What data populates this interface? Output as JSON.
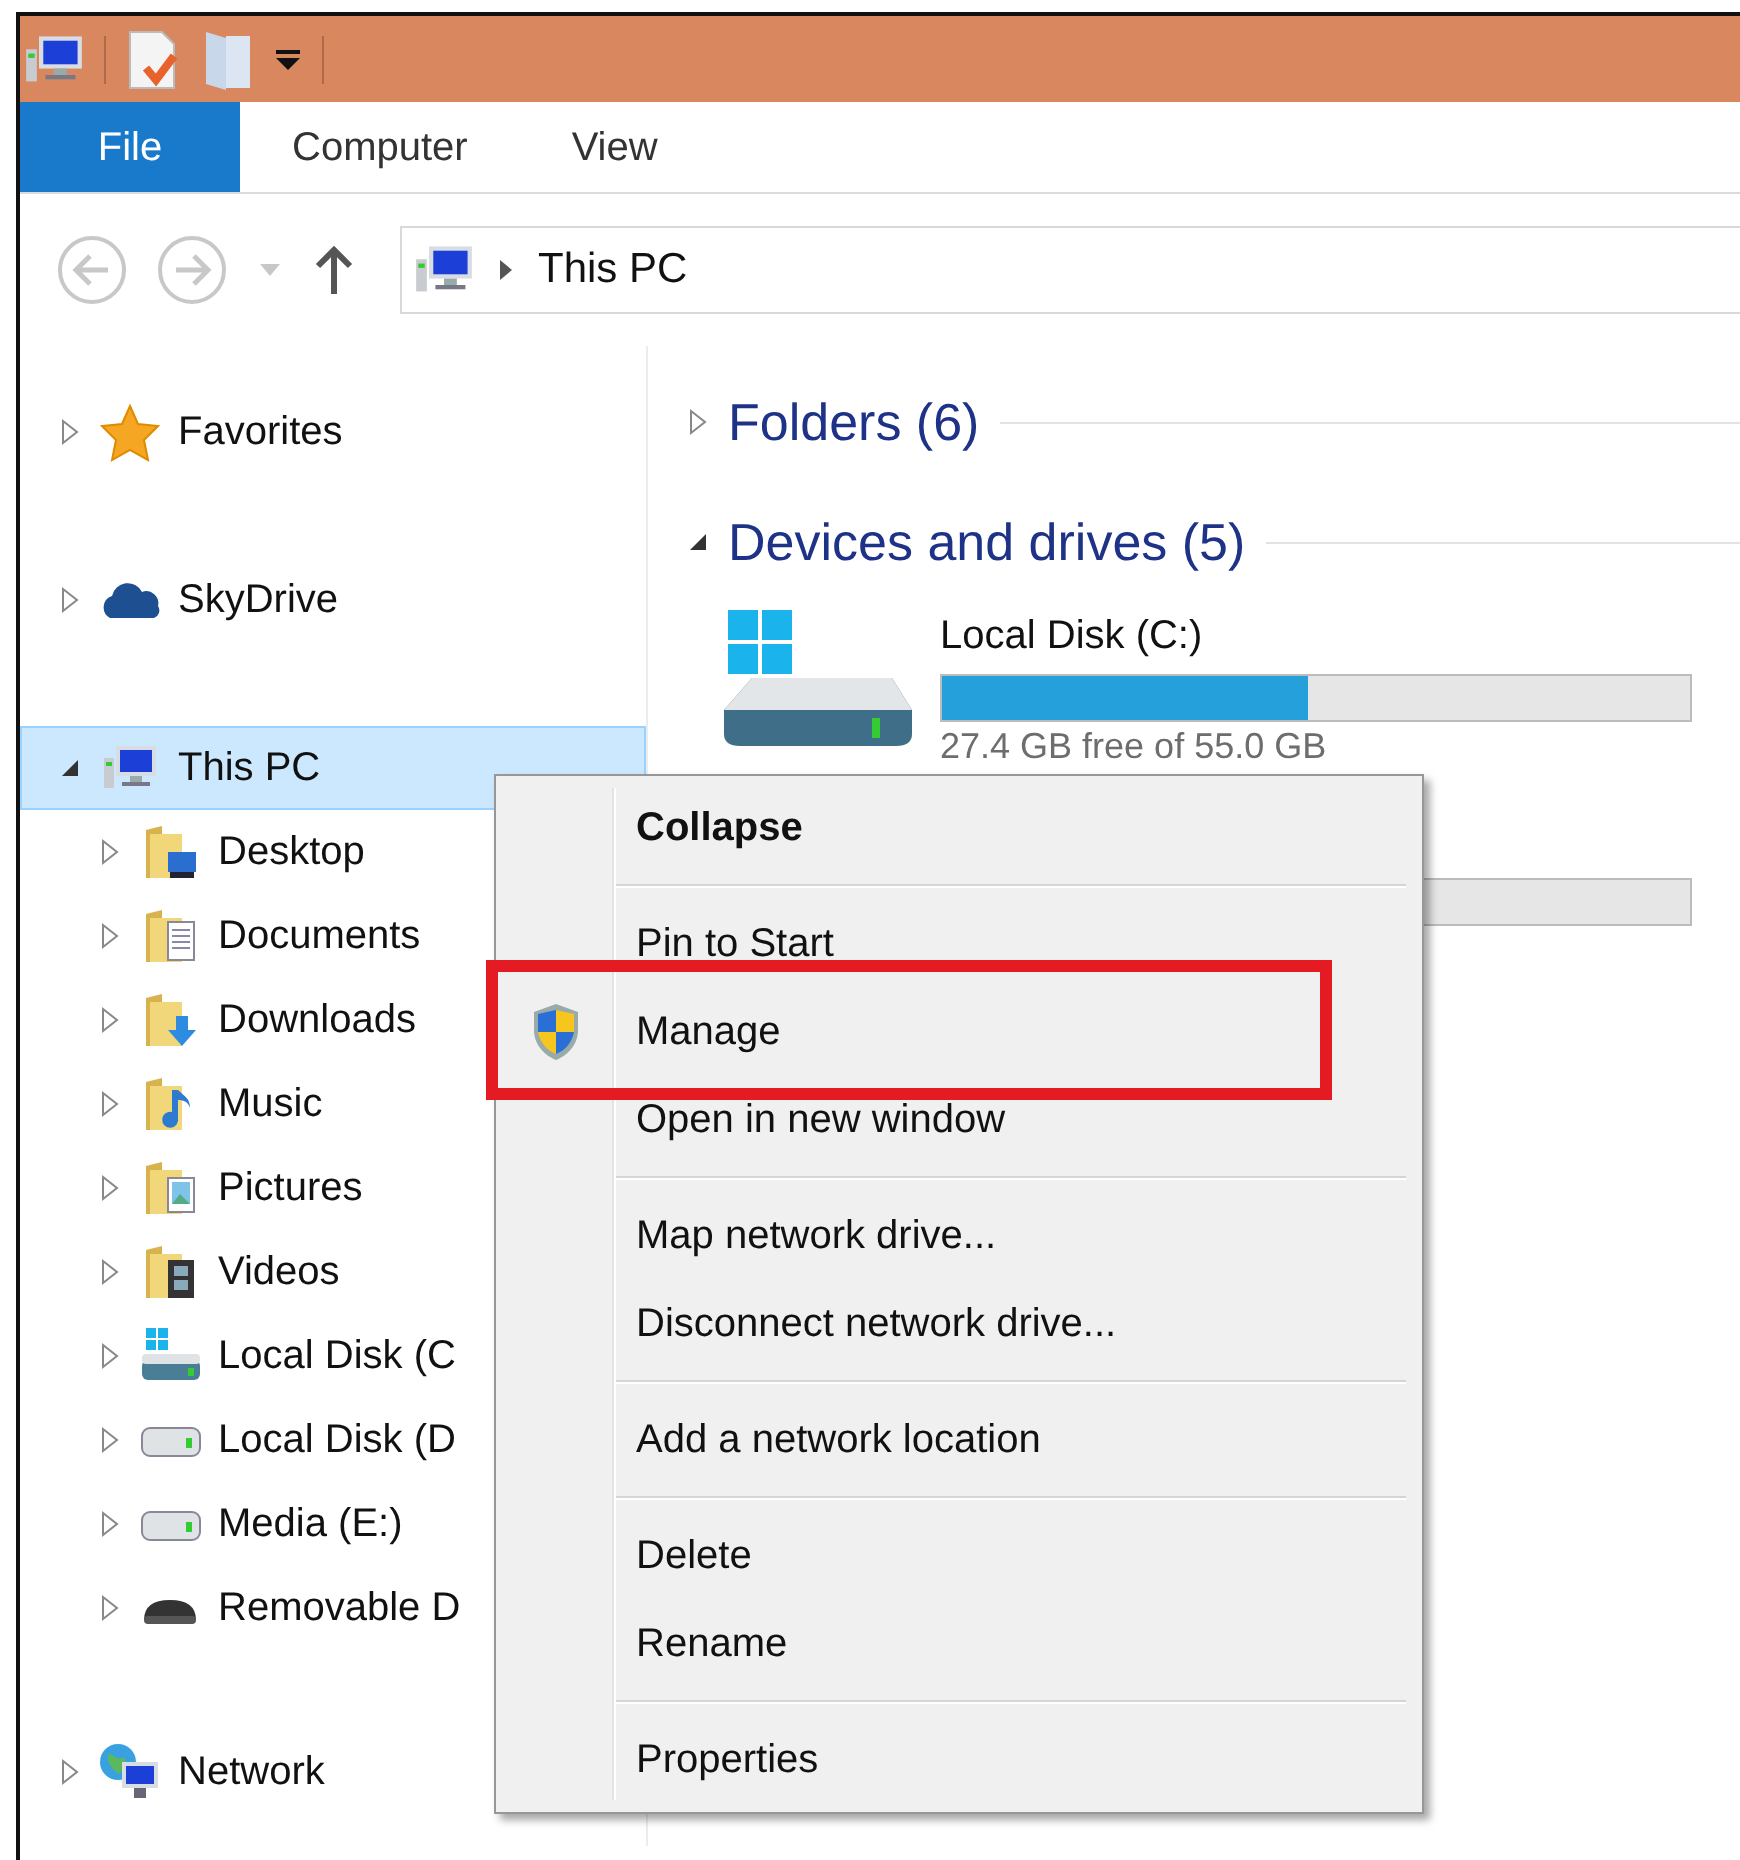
{
  "ribbon_tabs": [
    {
      "label": "File",
      "kind": "file"
    },
    {
      "label": "Computer",
      "kind": "tab"
    },
    {
      "label": "View",
      "kind": "tab"
    }
  ],
  "nav_buttons": [
    {
      "kind": "back",
      "disabled": true
    },
    {
      "kind": "forward",
      "disabled": true
    },
    {
      "kind": "recent",
      "disabled": true
    },
    {
      "kind": "up",
      "disabled": false
    }
  ],
  "address": {
    "breadcrumb": "This PC"
  },
  "tree": [
    {
      "label": "Favorites",
      "kind": "star",
      "expanded": false,
      "selected": false
    },
    {
      "label": "SkyDrive",
      "kind": "cloud",
      "expanded": false,
      "selected": false
    },
    {
      "label": "This PC",
      "kind": "computer",
      "expanded": true,
      "selected": true,
      "children": [
        {
          "label": "Desktop",
          "kind": "folder-desktop",
          "expanded": false,
          "selected": false
        },
        {
          "label": "Documents",
          "kind": "folder-documents",
          "expanded": false,
          "selected": false
        },
        {
          "label": "Downloads",
          "kind": "folder-downloads",
          "expanded": false,
          "selected": false
        },
        {
          "label": "Music",
          "kind": "folder-music",
          "expanded": false,
          "selected": false
        },
        {
          "label": "Pictures",
          "kind": "folder-pictures",
          "expanded": false,
          "selected": false
        },
        {
          "label": "Videos",
          "kind": "folder-videos",
          "expanded": false,
          "selected": false
        },
        {
          "label": "Local Disk (C",
          "kind": "system-drive",
          "expanded": false,
          "selected": false
        },
        {
          "label": "Local Disk (D",
          "kind": "drive",
          "expanded": false,
          "selected": false
        },
        {
          "label": "Media (E:)",
          "kind": "drive",
          "expanded": false,
          "selected": false
        },
        {
          "label": "Removable D",
          "kind": "removable",
          "expanded": false,
          "selected": false
        }
      ]
    },
    {
      "label": "Network",
      "kind": "network",
      "expanded": false,
      "selected": false
    }
  ],
  "groups": [
    {
      "title": "Folders (6)",
      "expanded": false
    },
    {
      "title": "Devices and drives (5)",
      "expanded": true
    }
  ],
  "drives": [
    {
      "name": "Local Disk (C:)",
      "level": 0.49,
      "free": "27.4 GB free of 55.0 GB"
    }
  ],
  "context_menu": [
    {
      "label": "Collapse",
      "kind": "default",
      "highlighted": false
    },
    {
      "kind": "separator"
    },
    {
      "label": "Pin to Start",
      "kind": "item",
      "highlighted": false
    },
    {
      "label": "Manage",
      "kind": "shield",
      "highlighted": true
    },
    {
      "label": "Open in new window",
      "kind": "item",
      "highlighted": false
    },
    {
      "kind": "separator"
    },
    {
      "label": "Map network drive...",
      "kind": "item",
      "highlighted": false
    },
    {
      "label": "Disconnect network drive...",
      "kind": "item",
      "highlighted": false
    },
    {
      "kind": "separator"
    },
    {
      "label": "Add a network location",
      "kind": "item",
      "highlighted": false
    },
    {
      "kind": "separator"
    },
    {
      "label": "Delete",
      "kind": "item",
      "highlighted": false
    },
    {
      "label": "Rename",
      "kind": "item",
      "highlighted": false
    },
    {
      "kind": "separator"
    },
    {
      "label": "Properties",
      "kind": "item",
      "highlighted": false
    }
  ]
}
